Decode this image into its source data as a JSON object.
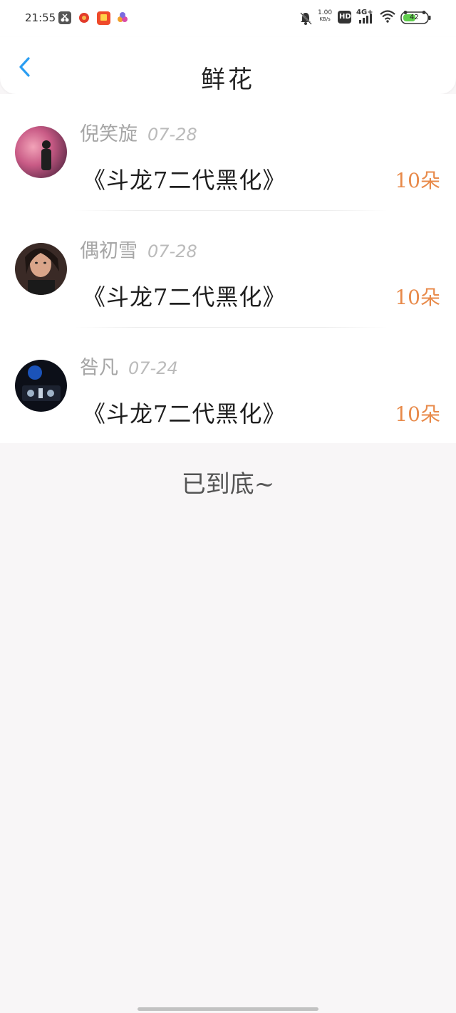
{
  "status_bar": {
    "time": "21:55",
    "network_speed_top": "1.00",
    "network_speed_unit": "KB/s",
    "hd_label": "HD",
    "signal_label": "4G+",
    "battery_level": "42"
  },
  "header": {
    "title": "鲜花"
  },
  "gifts": [
    {
      "name": "倪笑旋",
      "date": "07-28",
      "gift": "《斗龙7二代黑化》",
      "count": "10朵",
      "avatar": "avatar-smoke-portrait"
    },
    {
      "name": "偶初雪",
      "date": "07-28",
      "gift": "《斗龙7二代黑化》",
      "count": "10朵",
      "avatar": "avatar-woman-selfie"
    },
    {
      "name": "咎凡",
      "date": "07-24",
      "gift": "《斗龙7二代黑化》",
      "count": "10朵",
      "avatar": "avatar-dj-mixer"
    }
  ],
  "footer": {
    "end_text": "已到底~"
  },
  "colors": {
    "accent_blue": "#2b9ef2",
    "count_orange": "#e88a4a",
    "background": "#f8f6f7"
  }
}
